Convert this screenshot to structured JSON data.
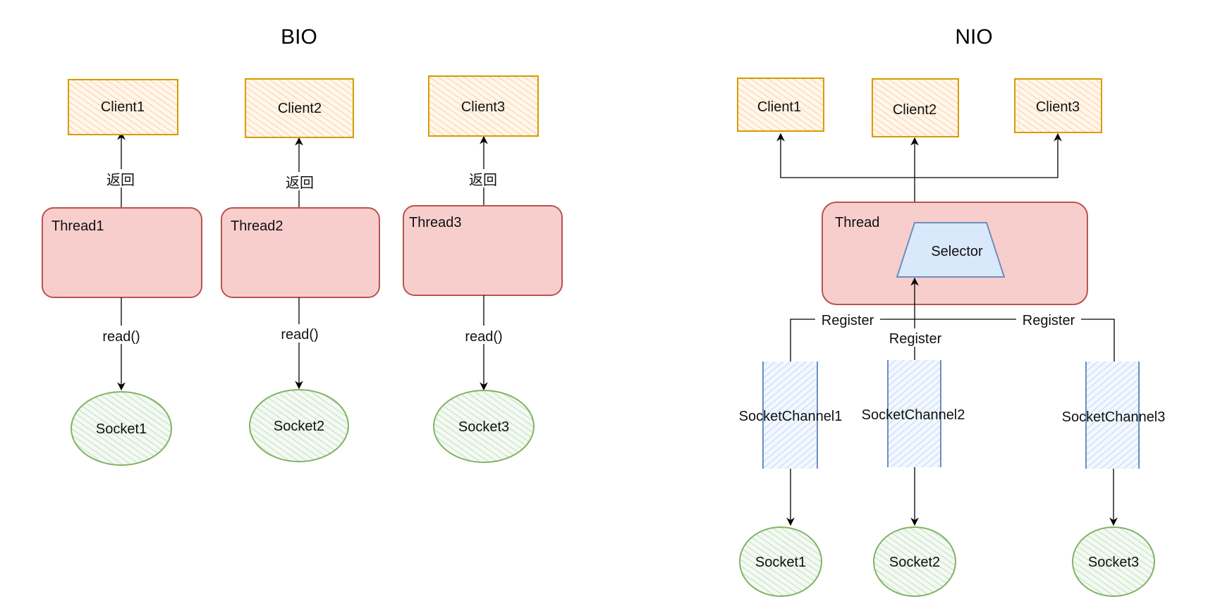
{
  "colors": {
    "client_fill": "#ffe6cc",
    "client_stroke": "#d79b00",
    "thread_fill": "#f8cecc",
    "thread_stroke": "#b85450",
    "socket_fill": "#d5e8d4",
    "socket_stroke": "#82b366",
    "channel_fill": "#dae8fc",
    "channel_stroke": "#6c8ebf",
    "edge": "#000000"
  },
  "bio": {
    "title": "BIO",
    "columns": [
      {
        "client": "Client1",
        "return_label": "返回",
        "thread": "Thread1",
        "read_label": "read()",
        "socket": "Socket1"
      },
      {
        "client": "Client2",
        "return_label": "返回",
        "thread": "Thread2",
        "read_label": "read()",
        "socket": "Socket2"
      },
      {
        "client": "Client3",
        "return_label": "返回",
        "thread": "Thread3",
        "read_label": "read()",
        "socket": "Socket3"
      }
    ]
  },
  "nio": {
    "title": "NIO",
    "clients": [
      "Client1",
      "Client2",
      "Client3"
    ],
    "thread": "Thread",
    "selector": "Selector",
    "register_labels": [
      "Register",
      "Register",
      "Register"
    ],
    "channels": [
      "SocketChannel1",
      "SocketChannel2",
      "SocketChannel3"
    ],
    "sockets": [
      "Socket1",
      "Socket2",
      "Socket3"
    ]
  }
}
